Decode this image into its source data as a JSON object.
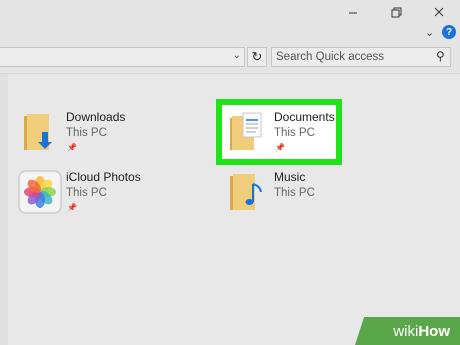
{
  "window": {
    "minimize_icon": "minimize-icon",
    "restore_icon": "restore-icon",
    "close_icon": "close-icon"
  },
  "ribbon": {
    "help_label": "?"
  },
  "address": {
    "refresh_icon": "refresh-icon",
    "search_placeholder": "Search Quick access"
  },
  "items": [
    {
      "name": "Downloads",
      "location": "This PC",
      "pinned": true,
      "icon": "downloads-folder-icon"
    },
    {
      "name": "Documents",
      "location": "This PC",
      "pinned": true,
      "icon": "documents-folder-icon",
      "highlighted": true
    },
    {
      "name": "iCloud Photos",
      "location": "This PC",
      "pinned": true,
      "icon": "icloud-photos-icon"
    },
    {
      "name": "Music",
      "location": "This PC",
      "pinned": false,
      "icon": "music-folder-icon"
    }
  ],
  "watermark": {
    "prefix": "wiki",
    "suffix": "How"
  },
  "colors": {
    "highlight": "#22e31b",
    "folder": "#e8c36c",
    "accent": "#1a73d8",
    "watermark": "#5aa64a"
  }
}
